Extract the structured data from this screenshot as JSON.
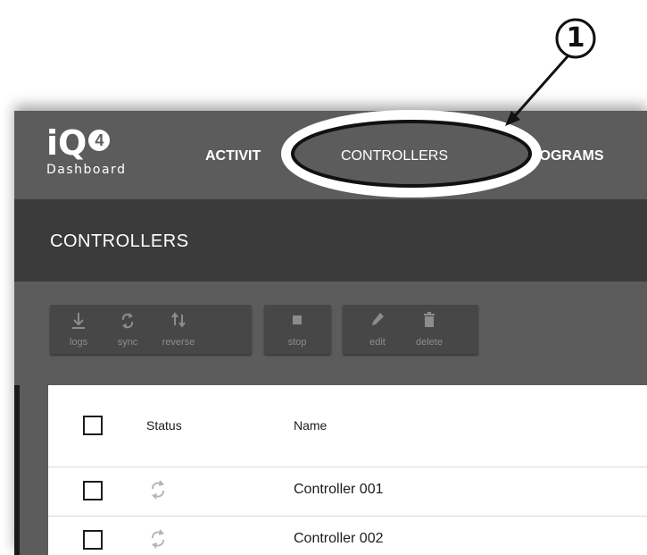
{
  "callout": {
    "number": "1"
  },
  "logo": {
    "mark_i": "i",
    "mark_q": "Q",
    "mark_4": "4",
    "word": "Dashboard"
  },
  "nav": {
    "activity": "ACTIVIT",
    "controllers": "CONTROLLERS",
    "programs": "ROGRAMS"
  },
  "subheader": {
    "title": "CONTROLLERS"
  },
  "toolbar": {
    "logs": "logs",
    "sync": "sync",
    "reverse": "reverse",
    "stop": "stop",
    "edit": "edit",
    "delete": "delete"
  },
  "table": {
    "headers": {
      "status": "Status",
      "name": "Name"
    },
    "rows": [
      {
        "name": "Controller 001",
        "status_icon": "sync-icon"
      },
      {
        "name": "Controller 002",
        "status_icon": "sync-icon"
      }
    ]
  },
  "colors": {
    "navbar": "#5c5c5c",
    "subheader": "#3b3b3b",
    "toolbar_button": "#474747",
    "table_bg": "#ffffff",
    "callout": "#111111"
  }
}
